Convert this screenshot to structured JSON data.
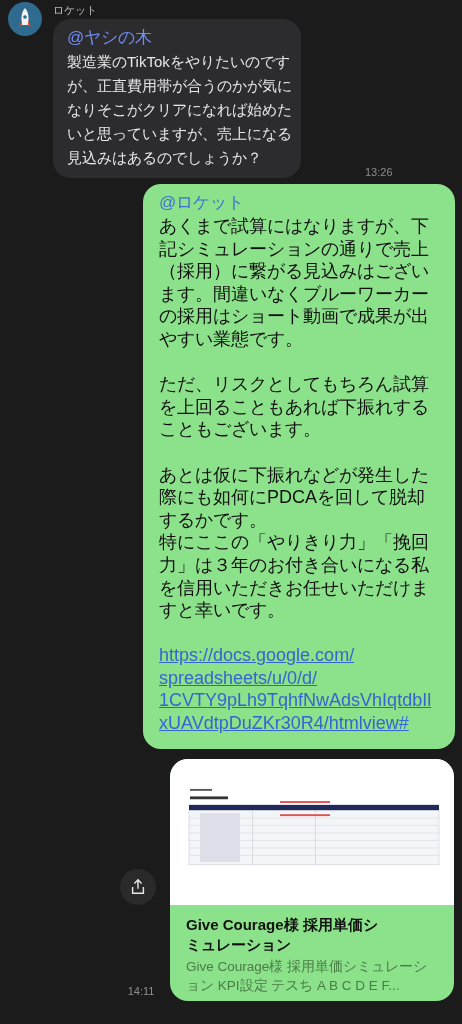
{
  "messages": [
    {
      "kind": "received",
      "sender": "ロケット",
      "mention": "@ヤシの木",
      "text": "製造業のTikTokをやりたいのですが、正直費用帯が合うのかが気になりそこがクリアになれば始めたいと思っていますが、売上になる見込みはあるのでしょうか？",
      "time": "13:26"
    },
    {
      "kind": "sent",
      "mention": "@ロケット",
      "paragraphs": [
        [
          "あくまで試算にはなりますが、下記シミュレーションの通りで売上（採用）に繋がる見込みはございます。間違いなくブルーワーカーの採用はショート動画で成果が出やすい業態です。"
        ],
        [
          "ただ、リスクとしてもちろん試算を上回ることもあれば下振れすることもございます。"
        ],
        [
          "あとは仮に下振れなどが発生した際にも如何にPDCAを回して脱却するかです。",
          "特にここの「やりきり力」「挽回力」は３年のお付き合いになる私を信用いただきお任せいただけますと幸いです。"
        ]
      ],
      "link": "https://docs.google.com/spreadsheets/u/0/d/1CVTY9pLh9TqhfNwAdsVhIqtdbIlxUAVdtpDuZKr30R4/htmlview#"
    },
    {
      "kind": "link_card",
      "title": "Give Courage様 採用単価シミュレーション",
      "description": "Give Courage様 採用単価シミュレーション KPI設定 テスち A B C D E F...",
      "time": "14:11"
    }
  ]
}
